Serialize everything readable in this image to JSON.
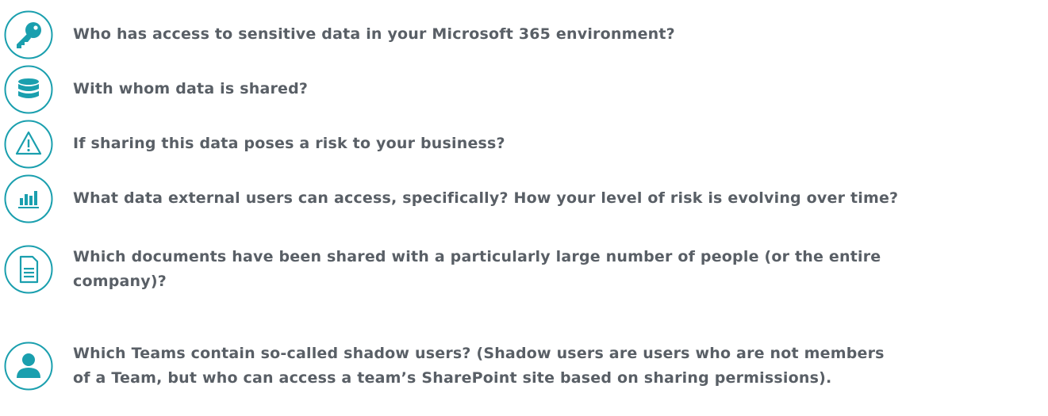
{
  "accent_color": "#1a9fae",
  "text_color": "#595f66",
  "items": [
    {
      "icon": "key-icon",
      "lines": [
        "Who has access to sensitive data in your Microsoft 365 environment?"
      ]
    },
    {
      "icon": "database-icon",
      "lines": [
        "With whom data is shared?"
      ]
    },
    {
      "icon": "warning-icon",
      "lines": [
        "If sharing this data poses a risk to your business?"
      ]
    },
    {
      "icon": "bar-chart-icon",
      "lines": [
        "What data external users can access, specifically? How your level of risk is evolving over time?"
      ]
    },
    {
      "icon": "document-icon",
      "lines": [
        "Which documents have been shared with a particularly large number of people (or the entire",
        "company)?"
      ]
    },
    {
      "icon": "user-icon",
      "lines": [
        "Which Teams contain so-called shadow users? (Shadow users are users who are not members",
        "of a Team, but who can access a team’s SharePoint site based on sharing permissions)."
      ]
    }
  ]
}
